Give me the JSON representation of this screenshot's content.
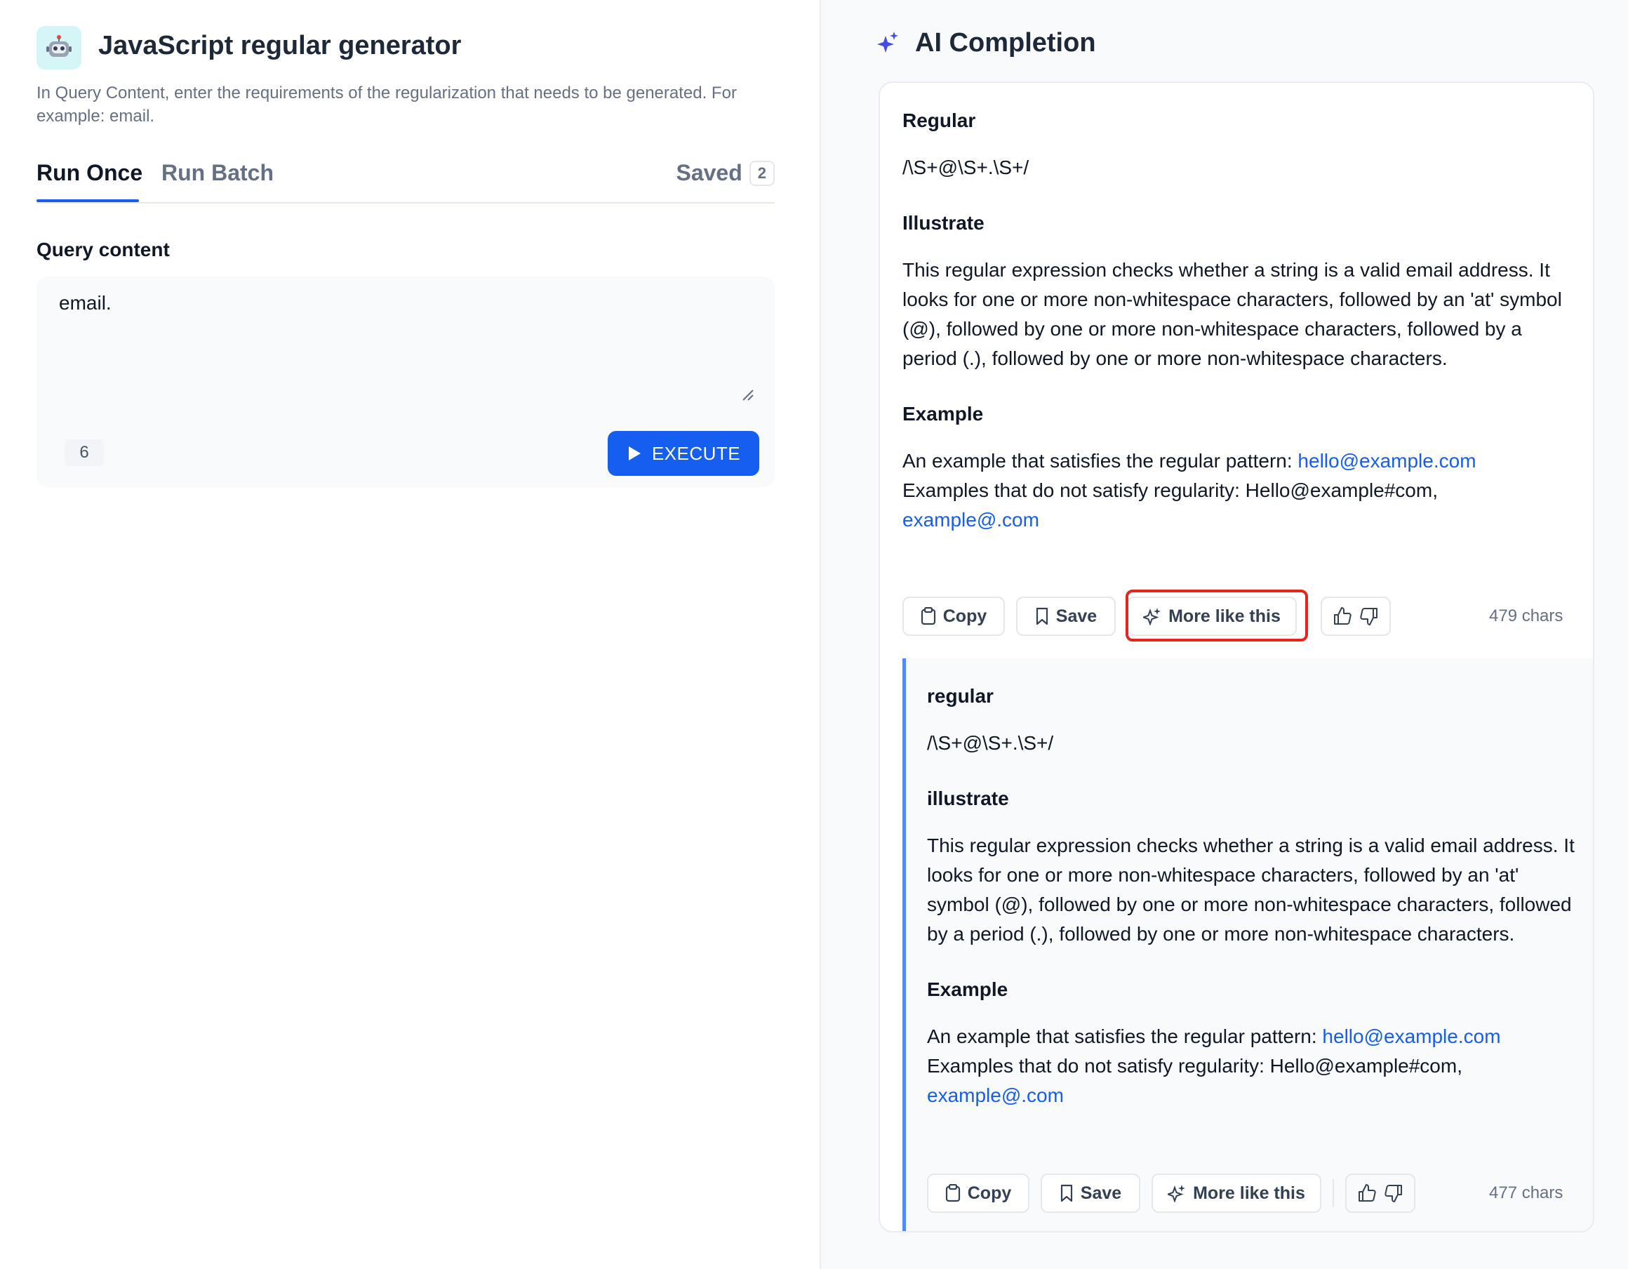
{
  "app": {
    "title": "JavaScript regular generator",
    "description": "In Query Content, enter the requirements of the regularization that needs to be generated. For example: email.",
    "icon": "robot-icon"
  },
  "tabs": {
    "run_once": "Run Once",
    "run_batch": "Run Batch",
    "saved_label": "Saved",
    "saved_count": "2"
  },
  "query": {
    "label": "Query content",
    "value": "email.",
    "char_count": "6",
    "execute_label": "EXECUTE"
  },
  "completion": {
    "title": "AI Completion",
    "accent_color": "#155eef",
    "highlight_color": "#e5251c",
    "results": [
      {
        "regular_heading": "Regular",
        "regex": "/\\S+@\\S+.\\S+/",
        "illustrate_heading": "Illustrate",
        "illustrate_text": "This regular expression checks whether a string is a valid email address. It looks for one or more non-whitespace characters, followed by an 'at' symbol (@), followed by one or more non-whitespace characters, followed by a period (.), followed by one or more non-whitespace characters.",
        "example_heading": "Example",
        "example_pos_prefix": "An example that satisfies the regular pattern: ",
        "example_pos_link": "hello@example.com",
        "example_neg_prefix": "Examples that do not satisfy regularity: Hello@example#com, ",
        "example_neg_link": "example@.com",
        "copy_label": "Copy",
        "save_label": "Save",
        "more_label": "More like this",
        "chars": "479 chars"
      },
      {
        "regular_heading": "regular",
        "regex": "/\\S+@\\S+.\\S+/",
        "illustrate_heading": "illustrate",
        "illustrate_text": "This regular expression checks whether a string is a valid email address. It looks for one or more non-whitespace characters, followed by an 'at' symbol (@), followed by one or more non-whitespace characters, followed by a period (.), followed by one or more non-whitespace characters.",
        "example_heading": "Example",
        "example_pos_prefix": "An example that satisfies the regular pattern: ",
        "example_pos_link": "hello@example.com",
        "example_neg_prefix": "Examples that do not satisfy regularity: Hello@example#com, ",
        "example_neg_link": "example@.com",
        "copy_label": "Copy",
        "save_label": "Save",
        "more_label": "More like this",
        "chars": "477 chars"
      }
    ]
  }
}
